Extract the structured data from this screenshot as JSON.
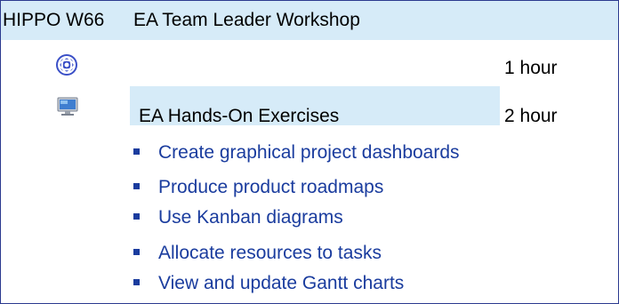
{
  "header": {
    "code": "HIPPO W66",
    "title": "EA Team Leader Workshop"
  },
  "rows": [
    {
      "icon": "workshop-swirl-icon",
      "label": "",
      "duration": "1 hour"
    },
    {
      "icon": "computer-monitor-icon",
      "label": "EA Hands-On Exercises",
      "duration": "2 hour"
    }
  ],
  "bullets": [
    "Create graphical project dashboards",
    "Produce product roadmaps",
    "Use Kanban diagrams",
    "Allocate resources to tasks",
    "View and update Gantt charts"
  ],
  "colors": {
    "header_bg": "#d6ebf8",
    "bullet_text": "#1a3c9e",
    "border": "#2b3a8f"
  }
}
